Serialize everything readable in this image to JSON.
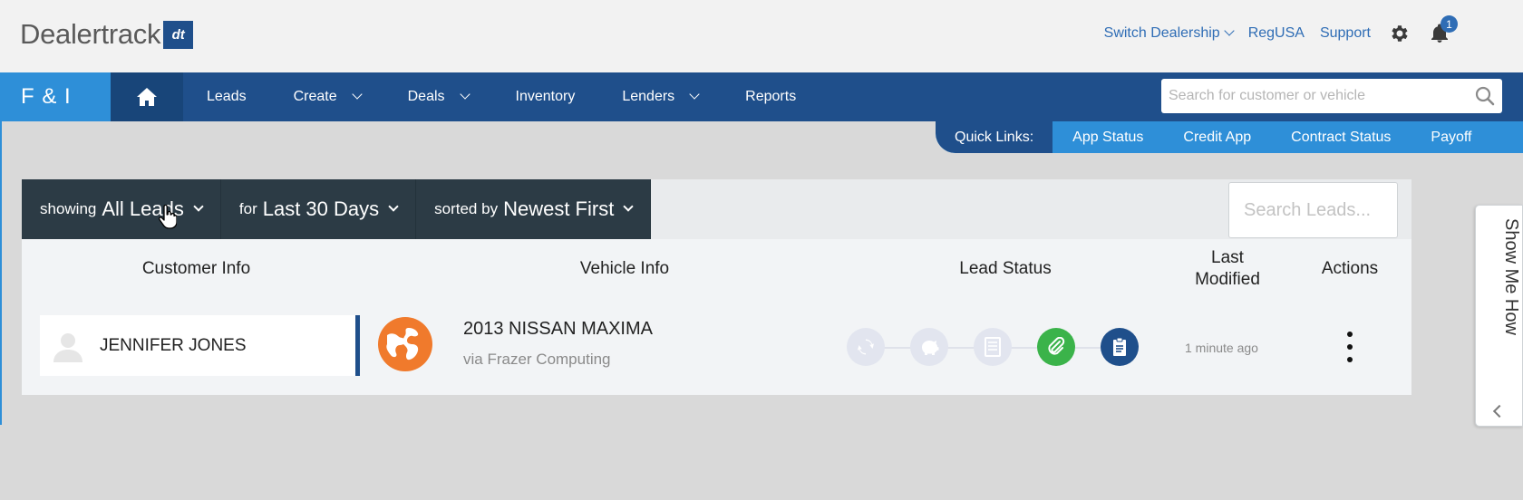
{
  "header": {
    "logo_text": "Dealertrack",
    "logo_badge": "dt",
    "links": [
      "Switch Dealership",
      "RegUSA",
      "Support"
    ],
    "notification_count": "1"
  },
  "nav": {
    "brand": "F & I",
    "items": [
      "Leads",
      "Create",
      "Deals",
      "Inventory",
      "Lenders",
      "Reports"
    ],
    "search_placeholder": "Search for customer or vehicle"
  },
  "quick_links": {
    "label": "Quick Links:",
    "items": [
      "App Status",
      "Credit App",
      "Contract Status",
      "Payoff"
    ]
  },
  "filters": {
    "showing_prefix": "showing",
    "showing_value": "All Leads",
    "period_prefix": "for",
    "period_value": "Last 30 Days",
    "sort_prefix": "sorted by",
    "sort_value": "Newest First",
    "search_placeholder": "Search Leads..."
  },
  "columns": {
    "customer": "Customer Info",
    "vehicle": "Vehicle Info",
    "status": "Lead Status",
    "modified_line1": "Last",
    "modified_line2": "Modified",
    "actions": "Actions"
  },
  "lead": {
    "customer_name": "JENNIFER JONES",
    "vehicle": "2013 NISSAN MAXIMA",
    "source": "via Frazer Computing",
    "last_modified": "1 minute ago",
    "status_steps": [
      "refresh",
      "piggy-bank",
      "document",
      "paperclip",
      "clipboard"
    ],
    "status_colors": {
      "inactive": "#e2e5ef",
      "attached": "#3bb34a",
      "current": "#1f4f8b"
    }
  },
  "help": {
    "show_me_how": "Show Me How"
  },
  "colors": {
    "brand_blue": "#1f4f8b",
    "accent_blue": "#2e8fd8",
    "filter_dark": "#2c3b45",
    "globe_orange": "#f07a2c"
  }
}
